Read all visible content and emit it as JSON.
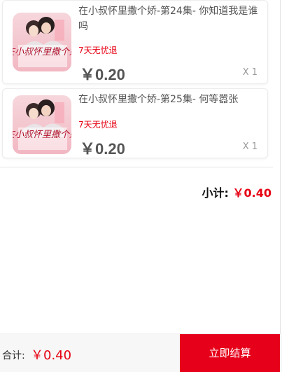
{
  "items": [
    {
      "title": "在小叔怀里撒个娇-第24集- 你知道我是谁吗",
      "tag": "7天无忧退",
      "price": "￥0.20",
      "qty": "X 1",
      "cover_text": "在小叔怀里撒个娇"
    },
    {
      "title": "在小叔怀里撒个娇-第25集- 何等嚣张",
      "tag": "7天无忧退",
      "price": "￥0.20",
      "qty": "X 1",
      "cover_text": "在小叔怀里撒个娇"
    }
  ],
  "subtotal": {
    "label": "小计:",
    "amount": "￥0.40"
  },
  "footer": {
    "total_label": "合计:",
    "total_amount": "￥0.40",
    "checkout_label": "立即结算"
  },
  "colors": {
    "accent": "#e60012",
    "checkout_bg": "#e60019"
  }
}
